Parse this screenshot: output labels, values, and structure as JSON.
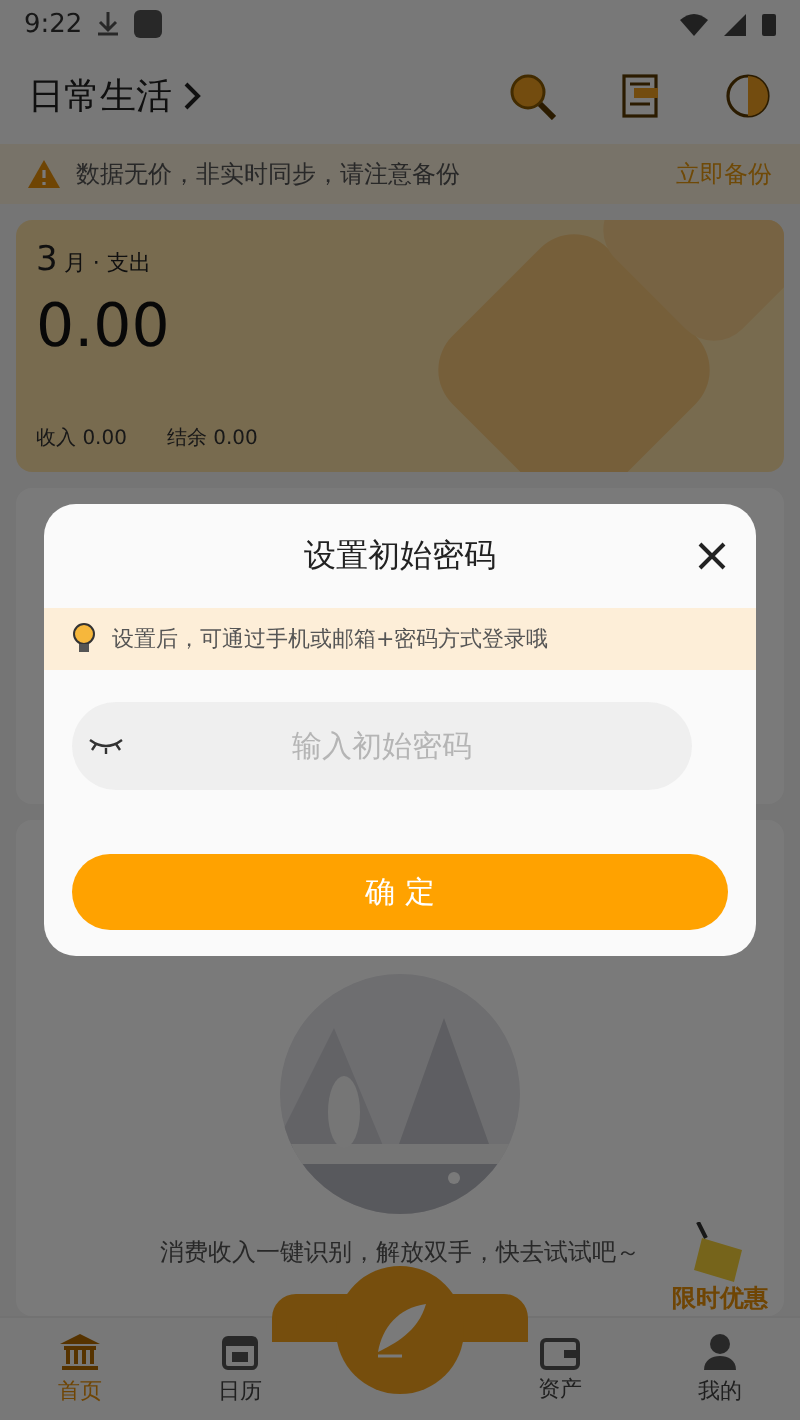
{
  "status_bar": {
    "time": "9:22"
  },
  "header": {
    "title": "日常生活"
  },
  "backup_banner": {
    "message": "数据无价，非实时同步，请注意备份",
    "action": "立即备份"
  },
  "summary_card": {
    "month": "3",
    "caption": "月 · 支出",
    "amount": "0.00",
    "income_label": "收入",
    "income": "0.00",
    "balance_label": "结余",
    "balance": "0.00"
  },
  "empty_state": {
    "message": "消费收入一键识别，解放双手，快去试试吧～"
  },
  "promo": {
    "label": "限时优惠"
  },
  "bottom_nav": [
    {
      "label": "首页",
      "selected": true
    },
    {
      "label": "日历",
      "selected": false
    },
    {
      "label": "资产",
      "selected": false
    },
    {
      "label": "我的",
      "selected": false
    }
  ],
  "dialog": {
    "title": "设置初始密码",
    "tip": "设置后，可通过手机或邮箱+密码方式登录哦",
    "password_field": {
      "placeholder": "输入初始密码"
    },
    "confirm": "确 定"
  }
}
